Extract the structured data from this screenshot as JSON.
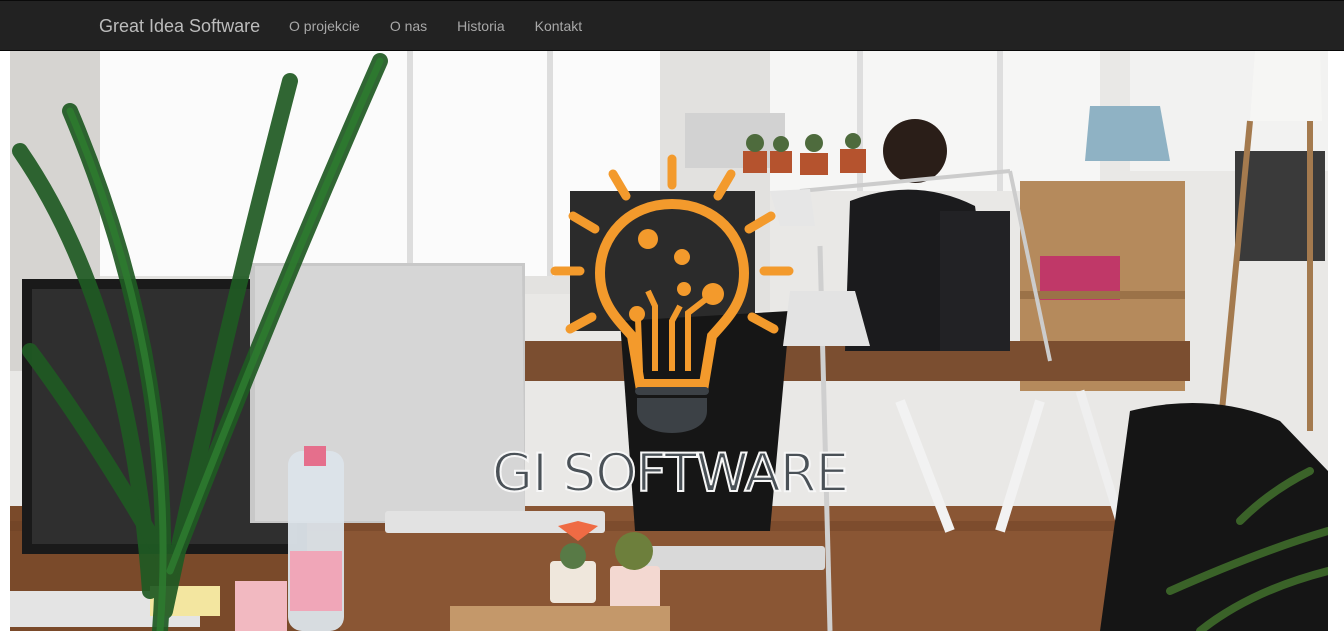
{
  "navbar": {
    "brand": "Great Idea Software",
    "links": [
      {
        "label": "O projekcie"
      },
      {
        "label": "O nas"
      },
      {
        "label": "Historia"
      },
      {
        "label": "Kontakt"
      }
    ]
  },
  "hero": {
    "logo": {
      "text": "GI SOFTWARE",
      "icon": "lightbulb-circuit-icon",
      "colors": {
        "bulb": "#f39a2c",
        "text": "#4a5157"
      }
    },
    "background": "office-photo"
  },
  "colors": {
    "navbar_bg": "#222222",
    "brand_text": "#bcbcbc",
    "nav_text": "#a8a8a8"
  }
}
